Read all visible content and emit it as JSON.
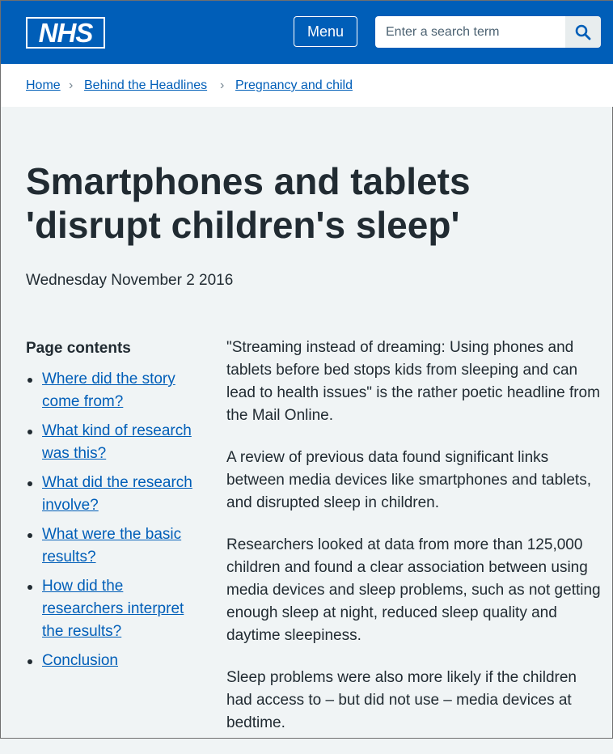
{
  "header": {
    "logo_text": "NHS",
    "menu_label": "Menu",
    "search_placeholder": "Enter a search term",
    "search_icon": "search-icon"
  },
  "breadcrumb": {
    "items": [
      "Home",
      "Behind the Headlines",
      "Pregnancy and child"
    ],
    "separator": "›"
  },
  "page": {
    "title": "Smartphones and tablets 'disrupt children's sleep'",
    "date": "Wednesday November 2 2016"
  },
  "contents": {
    "heading": "Page contents",
    "items": [
      "Where did the story come from?",
      "What kind of research was this?",
      "What did the research involve?",
      "What were the basic results?",
      "How did the researchers interpret the results?",
      "Conclusion"
    ]
  },
  "article": {
    "paragraphs": [
      "\"Streaming instead of dreaming: Using phones and tablets before bed stops kids from sleeping and can lead to health issues\" is the rather poetic headline from the Mail Online.",
      "A review of previous data found significant links between media devices like smartphones and tablets, and disrupted sleep in children.",
      "Researchers looked at data from more than 125,000 children and found a clear association between using media devices and sleep problems, such as not getting enough sleep at night, reduced sleep quality and daytime sleepiness.",
      "Sleep problems were also more likely if the children had access to – but did not use – media devices at bedtime."
    ]
  },
  "colors": {
    "brand_blue": "#005eb8",
    "link": "#005eb8",
    "text": "#212b32",
    "background": "#f0f4f5"
  }
}
